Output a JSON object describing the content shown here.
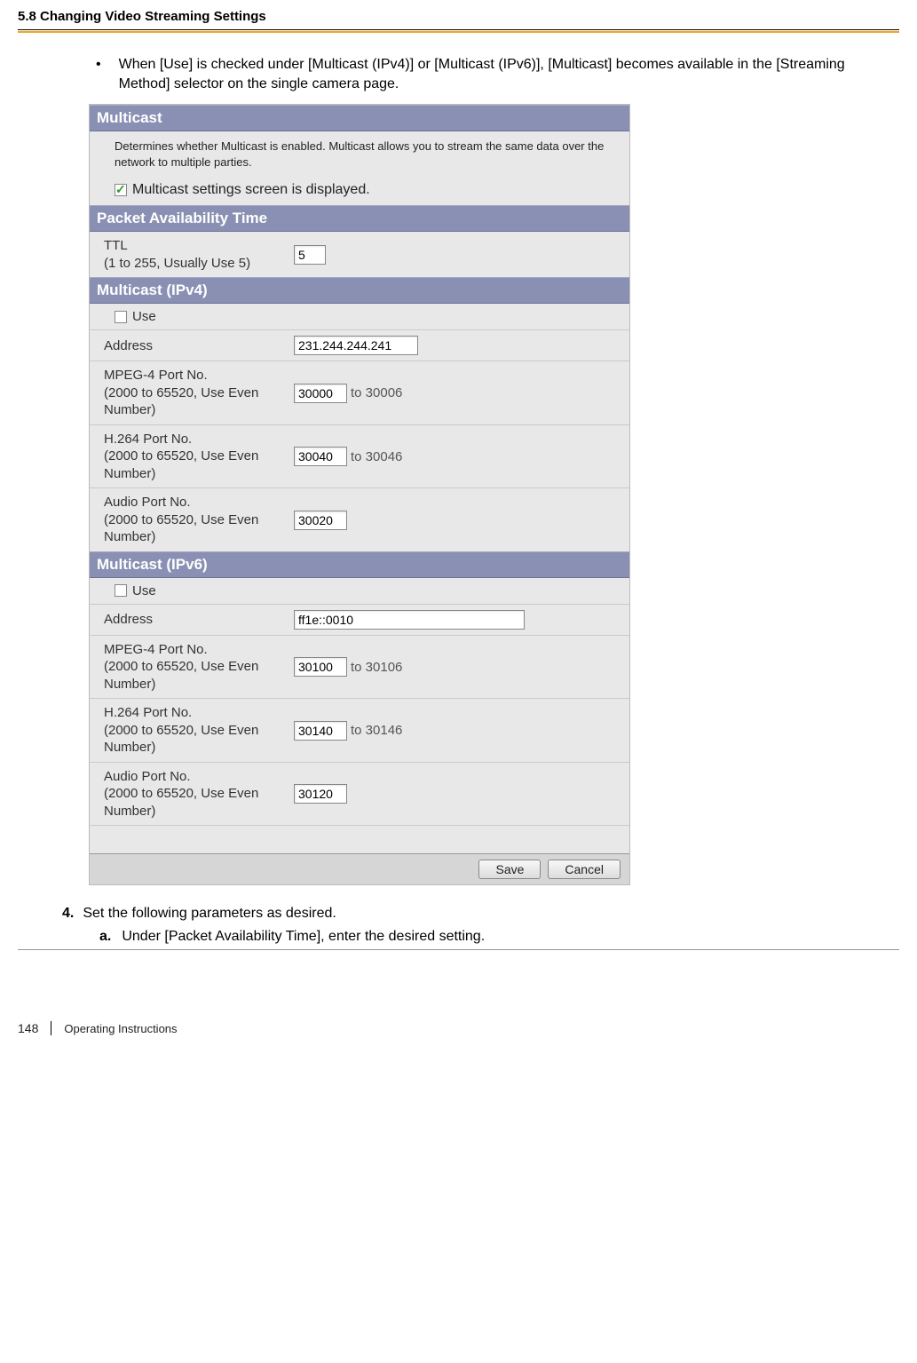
{
  "header": {
    "section": "5.8 Changing Video Streaming Settings"
  },
  "bullet": {
    "text": "When [Use] is checked under [Multicast (IPv4)] or [Multicast (IPv6)], [Multicast] becomes available in the [Streaming Method] selector on the single camera page."
  },
  "panel": {
    "multicast": {
      "title": "Multicast",
      "desc": "Determines whether Multicast is enabled. Multicast allows you to stream the same data over the network to multiple parties.",
      "check_label": "Multicast settings screen is displayed."
    },
    "packet": {
      "title": "Packet Availability Time",
      "ttl_label": "TTL\n(1 to 255, Usually Use 5)",
      "ttl_value": "5"
    },
    "ipv4": {
      "title": "Multicast (IPv4)",
      "use_label": "Use",
      "address_label": "Address",
      "address_value": "231.244.244.241",
      "mpeg_label": "MPEG-4 Port No.\n(2000 to 65520, Use Even Number)",
      "mpeg_value": "30000",
      "mpeg_to": "to 30006",
      "h264_label": "H.264 Port No.\n(2000 to 65520, Use Even Number)",
      "h264_value": "30040",
      "h264_to": "to 30046",
      "audio_label": "Audio Port No.\n(2000 to 65520, Use Even Number)",
      "audio_value": "30020"
    },
    "ipv6": {
      "title": "Multicast (IPv6)",
      "use_label": "Use",
      "address_label": "Address",
      "address_value": "ff1e::0010",
      "mpeg_label": "MPEG-4 Port No.\n(2000 to 65520, Use Even Number)",
      "mpeg_value": "30100",
      "mpeg_to": "to 30106",
      "h264_label": "H.264 Port No.\n(2000 to 65520, Use Even Number)",
      "h264_value": "30140",
      "h264_to": "to 30146",
      "audio_label": "Audio Port No.\n(2000 to 65520, Use Even Number)",
      "audio_value": "30120"
    },
    "buttons": {
      "save": "Save",
      "cancel": "Cancel"
    }
  },
  "instructions": {
    "step4_num": "4.",
    "step4_text": "Set the following parameters as desired.",
    "step4a_num": "a.",
    "step4a_text": "Under [Packet Availability Time], enter the desired setting."
  },
  "footer": {
    "page": "148",
    "label": "Operating Instructions"
  }
}
